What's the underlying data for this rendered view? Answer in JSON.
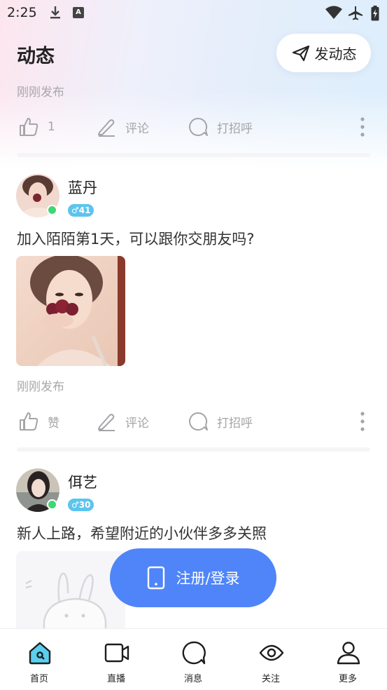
{
  "status_bar": {
    "time": "2:25"
  },
  "header": {
    "title": "动态",
    "post_button_label": "发动态"
  },
  "feed": [
    {
      "time_text": "刚刚发布",
      "actions": {
        "like": "1",
        "comment": "评论",
        "greet": "打招呼"
      }
    },
    {
      "user_name": "蓝丹",
      "age_badge": "41",
      "gender_symbol": "♂",
      "content": "加入陌陌第1天，可以跟你交朋友吗?",
      "time_text": "刚刚发布",
      "actions": {
        "like": "赞",
        "comment": "评论",
        "greet": "打招呼"
      }
    },
    {
      "user_name": "佴艺",
      "age_badge": "30",
      "gender_symbol": "♂",
      "content": "新人上路，希望附近的小伙伴多多关照"
    }
  ],
  "register_button": {
    "label": "注册/登录"
  },
  "bottom_nav": [
    {
      "label": "首页",
      "icon": "home-icon",
      "active": true
    },
    {
      "label": "直播",
      "icon": "video-icon"
    },
    {
      "label": "消息",
      "icon": "message-icon"
    },
    {
      "label": "关注",
      "icon": "eye-icon"
    },
    {
      "label": "更多",
      "icon": "profile-icon"
    }
  ],
  "colors": {
    "accent": "#4f85f8",
    "online": "#3ed873",
    "badge": "#5cc4ee",
    "active_nav": "#5ad0ee"
  }
}
